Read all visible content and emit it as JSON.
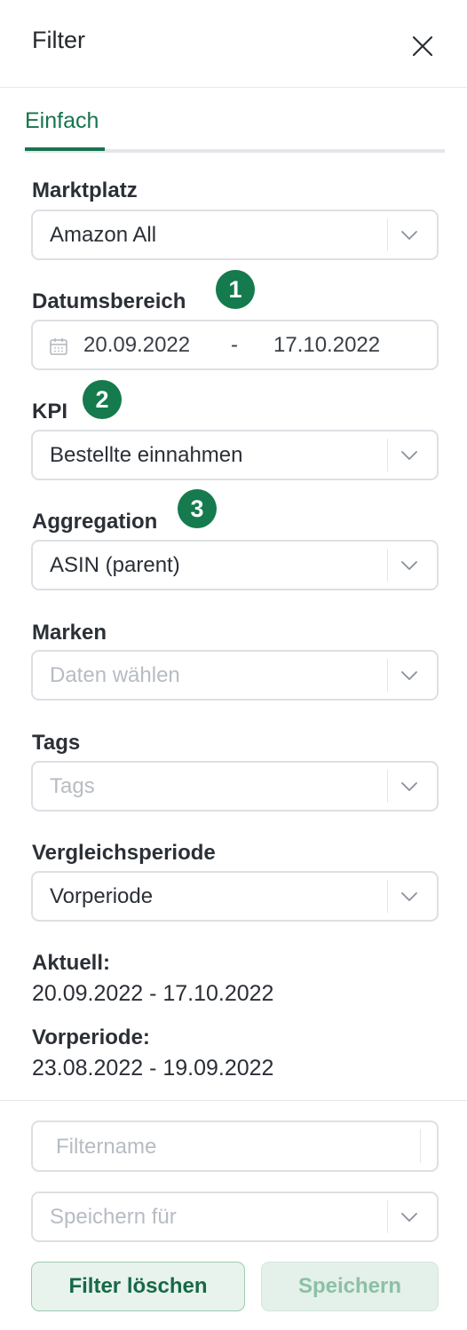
{
  "header": {
    "title": "Filter",
    "close_icon": "close-icon"
  },
  "tabs": [
    {
      "label": "Einfach",
      "active": true
    }
  ],
  "marketplace": {
    "label": "Marktplatz",
    "value": "Amazon All"
  },
  "date_range": {
    "label": "Datumsbereich",
    "from": "20.09.2022",
    "separator": "-",
    "to": "17.10.2022",
    "icon": "calendar-icon"
  },
  "kpi": {
    "label": "KPI",
    "value": "Bestellte einnahmen"
  },
  "aggregation": {
    "label": "Aggregation",
    "value": "ASIN (parent)"
  },
  "brands": {
    "label": "Marken",
    "placeholder": "Daten wählen"
  },
  "tags": {
    "label": "Tags",
    "placeholder": "Tags"
  },
  "comparison": {
    "label": "Vergleichsperiode",
    "value": "Vorperiode"
  },
  "period_info": {
    "current_label": "Aktuell:",
    "current_value": "20.09.2022 - 17.10.2022",
    "previous_label": "Vorperiode:",
    "previous_value": "23.08.2022 - 19.09.2022"
  },
  "annotations": {
    "one": "1",
    "two": "2",
    "three": "3"
  },
  "footer": {
    "filter_name_placeholder": "Filtername",
    "save_for_placeholder": "Speichern für",
    "clear_label": "Filter löschen",
    "save_label": "Speichern"
  },
  "colors": {
    "accent": "#17744f",
    "badge": "#157a4e",
    "border": "#dcdfe3",
    "placeholder": "#b7bcc3"
  }
}
